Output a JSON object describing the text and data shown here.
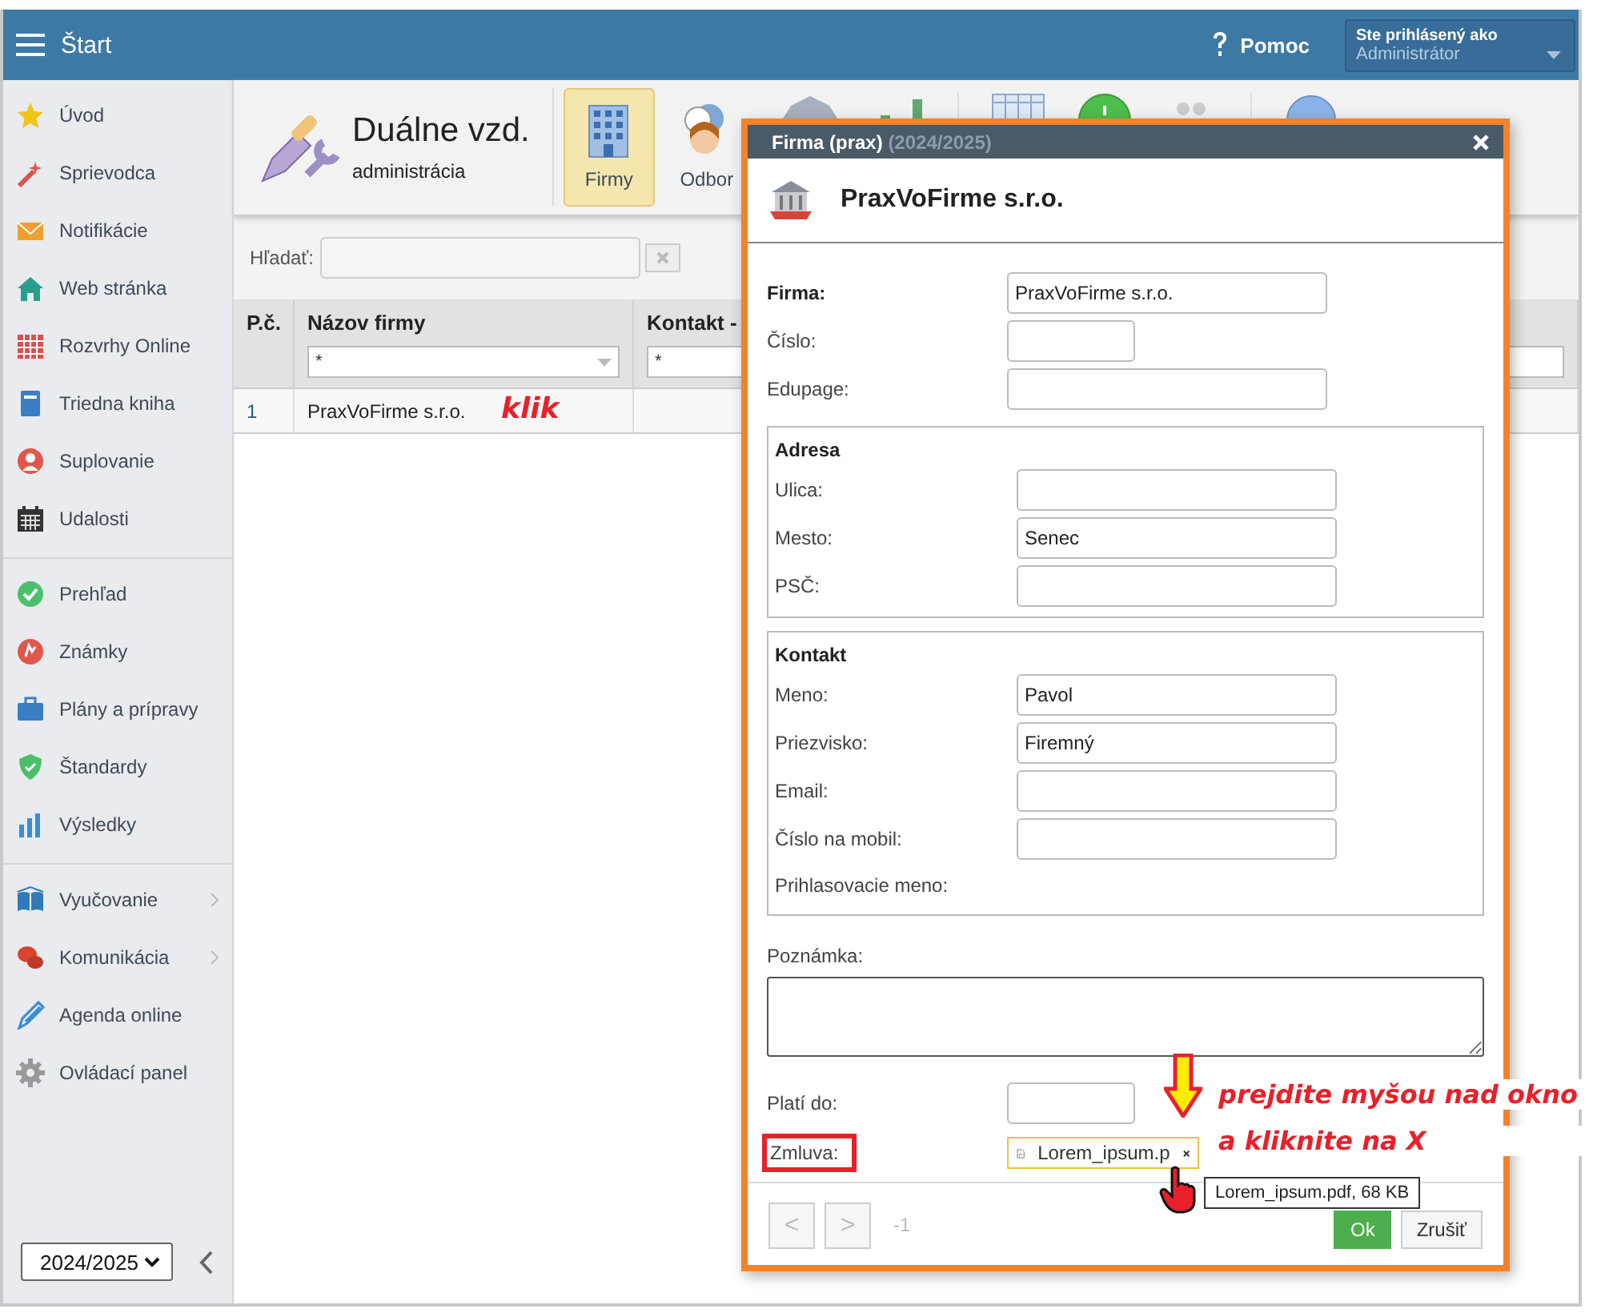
{
  "top_bar": {
    "title": "Štart",
    "help": "Pomoc",
    "user_label": "Ste prihlásený ako",
    "user_name": "Administrátor"
  },
  "sidebar": {
    "groups": [
      {
        "items": [
          {
            "label": "Úvod",
            "submenu": false
          },
          {
            "label": "Sprievodca",
            "submenu": false
          },
          {
            "label": "Notifikácie",
            "submenu": false
          },
          {
            "label": "Web stránka",
            "submenu": false
          },
          {
            "label": "Rozvrhy Online",
            "submenu": false
          },
          {
            "label": "Triedna kniha",
            "submenu": false
          },
          {
            "label": "Suplovanie",
            "submenu": false
          },
          {
            "label": "Udalosti",
            "submenu": false
          }
        ]
      },
      {
        "items": [
          {
            "label": "Prehľad",
            "submenu": false
          },
          {
            "label": "Známky",
            "submenu": false
          },
          {
            "label": "Plány a prípravy",
            "submenu": false
          },
          {
            "label": "Štandardy",
            "submenu": false
          },
          {
            "label": "Výsledky",
            "submenu": false
          }
        ]
      },
      {
        "items": [
          {
            "label": "Vyučovanie",
            "submenu": true
          },
          {
            "label": "Komunikácia",
            "submenu": true
          },
          {
            "label": "Agenda online",
            "submenu": false
          },
          {
            "label": "Ovládací panel",
            "submenu": false
          }
        ]
      }
    ],
    "year_select": "2024/2025"
  },
  "module": {
    "title": "Duálne vzd.",
    "subtitle": "administrácia",
    "tabs": [
      {
        "label": "Firmy",
        "selected": true
      },
      {
        "label": "Odbor",
        "selected": false
      }
    ]
  },
  "search": {
    "label": "Hľadať:"
  },
  "table": {
    "columns": [
      {
        "label": "P.č."
      },
      {
        "label": "Názov firmy",
        "filter": "*"
      },
      {
        "label": "Kontakt -",
        "filter": "*"
      }
    ],
    "rows": [
      {
        "number": "1",
        "name": "PraxVoFirme s.r.o."
      }
    ]
  },
  "dialog": {
    "title": "Firma (prax)",
    "year": "(2024/2025)",
    "heading": "PraxVoFirme s.r.o.",
    "fields": [
      {
        "label": "Firma:",
        "value": "PraxVoFirme s.r.o.",
        "kind": "wide",
        "required": true
      },
      {
        "label": "Číslo:",
        "kind": "short",
        "required": false
      },
      {
        "label": "Edupage:",
        "kind": "wide",
        "required": false
      }
    ],
    "sections": [
      {
        "title": "Adresa",
        "fields": [
          {
            "label": "Ulica:",
            "kind": "wide"
          },
          {
            "label": "Mesto:",
            "value": "Senec",
            "kind": "wide"
          },
          {
            "label": "PSČ:",
            "kind": "wide"
          }
        ]
      },
      {
        "title": "Kontakt",
        "fields": [
          {
            "label": "Meno:",
            "value": "Pavol",
            "kind": "wide"
          },
          {
            "label": "Priezvisko:",
            "value": "Firemný",
            "kind": "wide"
          },
          {
            "label": "Email:",
            "kind": "wide"
          },
          {
            "label": "Číslo na mobil:",
            "kind": "wide"
          },
          {
            "label": "Prihlasovacie meno:",
            "kind": "text"
          }
        ]
      }
    ],
    "note_label": "Poznámka:",
    "valid_label": "Platí do:",
    "contract_label": "Zmluva:",
    "attachment": "Lorem_ipsum.p",
    "tooltip": "Lorem_ipsum.pdf, 68 KB",
    "pager": {
      "prev": "<",
      "next": ">",
      "count": "-1",
      "disabled": true
    },
    "buttons": [
      {
        "label": "Ok",
        "kind": "primary"
      },
      {
        "label": "Zrušiť",
        "kind": "secondary"
      }
    ]
  },
  "annotations": {
    "click": "klik",
    "instruction": [
      "prejdite myšou nad okno",
      "a kliknite na X"
    ]
  }
}
